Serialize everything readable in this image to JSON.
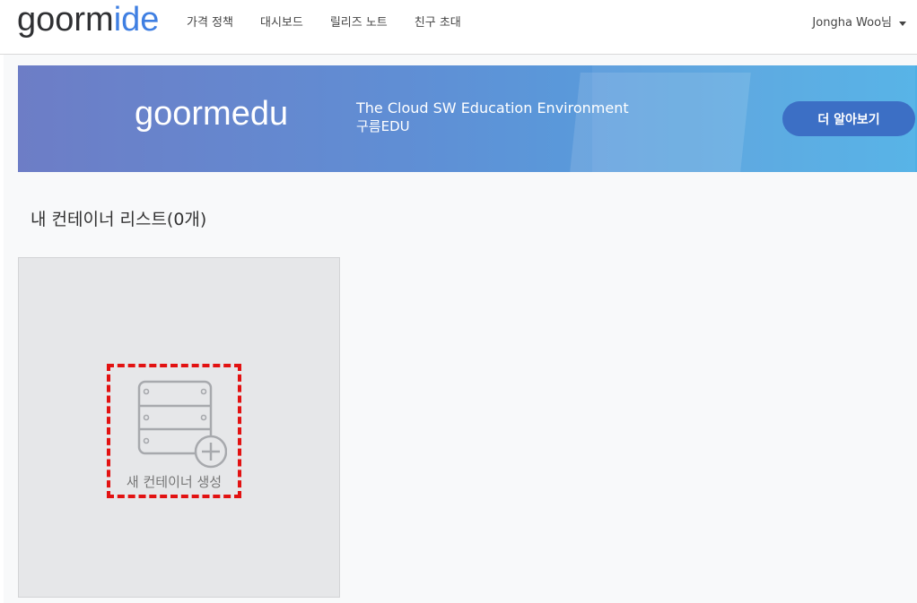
{
  "header": {
    "logo_part1": "goorm",
    "logo_part2": "ide",
    "nav": [
      "가격 정책",
      "대시보드",
      "릴리즈 노트",
      "친구 초대"
    ],
    "user_name": "Jongha Woo님"
  },
  "banner": {
    "logo": "goormedu",
    "line1": "The Cloud SW Education Environment",
    "line2": "구름EDU",
    "button": "더 알아보기"
  },
  "containers": {
    "title": "내 컨테이너 리스트(0개)",
    "create_label": "새 컨테이너 생성"
  },
  "colors": {
    "accent": "#3f7fe2",
    "banner_button": "#3c6fc5",
    "highlight_dash": "#e21212"
  },
  "icons": {
    "user_menu": "caret-down-icon",
    "create": "server-add-icon"
  }
}
